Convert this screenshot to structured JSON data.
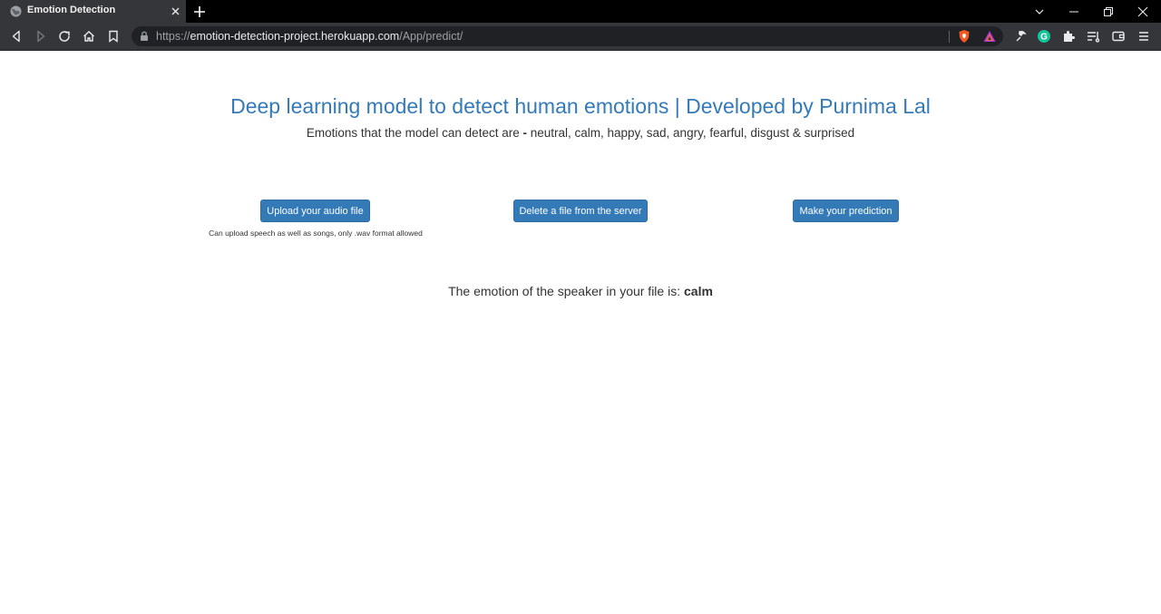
{
  "browser": {
    "tab_title": "Emotion Detection",
    "url_scheme": "https://",
    "url_host": "emotion-detection-project.herokuapp.com",
    "url_path": "/App/predict/",
    "icons": [
      "globe-icon",
      "close-icon",
      "plus-icon",
      "chevron-down-icon",
      "minimize-icon",
      "restore-icon",
      "close-window-icon",
      "back-icon",
      "forward-icon",
      "reload-icon",
      "home-icon",
      "bookmark-icon",
      "lock-icon",
      "brave-shields-icon",
      "brave-rewards-icon",
      "extension-icon",
      "grammarly-icon",
      "puzzle-icon",
      "reading-list-icon",
      "wallet-icon",
      "menu-icon"
    ]
  },
  "page": {
    "heading": "Deep learning model to detect human emotions | Developed by Purnima Lal",
    "subheading_prefix": "Emotions that the model can detect are ",
    "subheading_dash": "-",
    "subheading_list": " neutral, calm, happy, sad, angry, fearful, disgust & surprised",
    "buttons": {
      "upload": "Upload your audio file",
      "delete": "Delete a file from the server",
      "predict": "Make your prediction"
    },
    "upload_hint": "Can upload speech as well as songs, only .wav format allowed",
    "result_prefix": "The emotion of the speaker in your file is: ",
    "result_value": "calm"
  },
  "colors": {
    "accent": "#337ab7",
    "text": "#333333",
    "chrome_dark": "#35363a"
  }
}
